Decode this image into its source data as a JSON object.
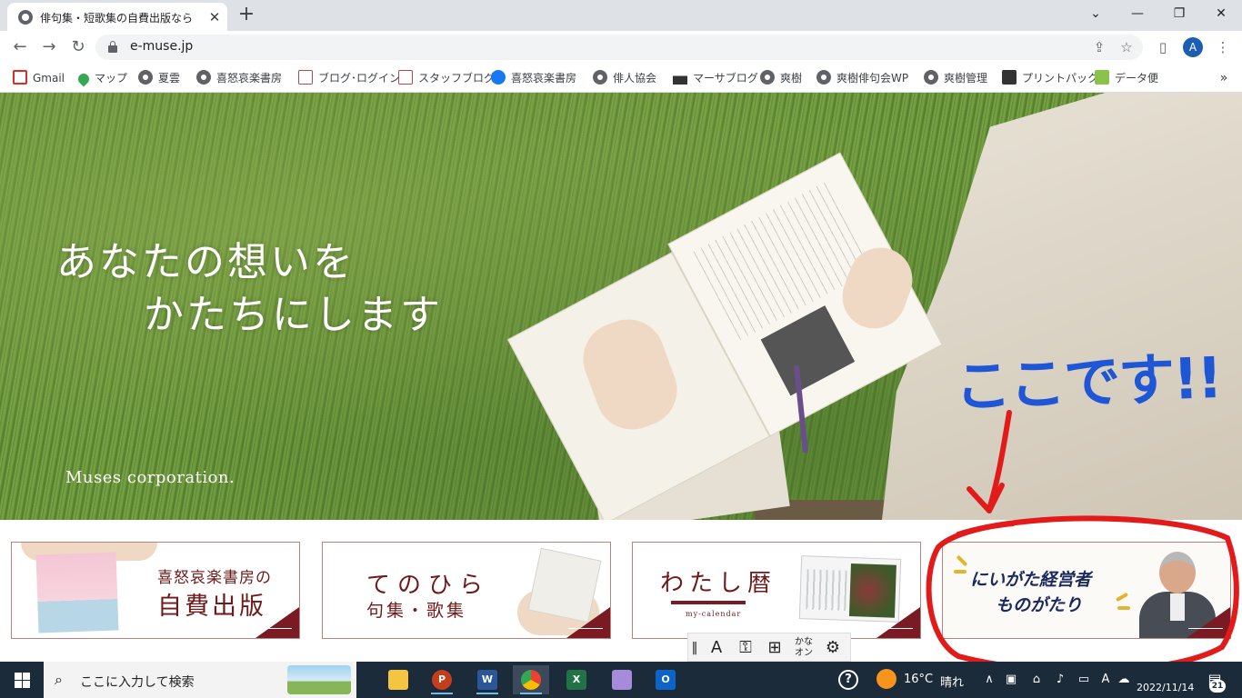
{
  "browser": {
    "tab_title": "俳句集・短歌集の自費出版なら 喜",
    "tab_close_glyph": "✕",
    "new_tab_glyph": "+",
    "url": "e-muse.jp",
    "window_controls": {
      "tabs_menu": "⌄",
      "minimize": "—",
      "restore": "❐",
      "close": "✕"
    },
    "avatar_letter": "A",
    "more_glyph": "⋮",
    "bookmarks_more_glyph": "»",
    "bookmarks": [
      {
        "label": "Gmail",
        "icon": "gmail-icon"
      },
      {
        "label": "マップ",
        "icon": "maps-icon"
      },
      {
        "label": "夏雲",
        "icon": "globe-icon"
      },
      {
        "label": "喜怒哀楽書房",
        "icon": "globe-icon"
      },
      {
        "label": "ブログ･ログイン",
        "icon": "blog-icon"
      },
      {
        "label": "スタッフブログ",
        "icon": "blog-icon"
      },
      {
        "label": "喜怒哀楽書房",
        "icon": "facebook-icon"
      },
      {
        "label": "俳人協会",
        "icon": "globe-icon"
      },
      {
        "label": "マーサブログ",
        "icon": "muse-icon"
      },
      {
        "label": "爽樹",
        "icon": "globe-icon"
      },
      {
        "label": "爽樹俳句会WP",
        "icon": "globe-icon"
      },
      {
        "label": "爽樹管理",
        "icon": "globe-icon"
      },
      {
        "label": "プリントパック",
        "icon": "printpac-icon"
      },
      {
        "label": "データ便",
        "icon": "cube-icon"
      }
    ]
  },
  "hero": {
    "headline_line1": "あなたの想いを",
    "headline_line2": "かたちにします",
    "brand": "Muses corporation.",
    "annotation": "ここです!!"
  },
  "banners": [
    {
      "line1": "喜怒哀楽書房の",
      "line2": "自費出版"
    },
    {
      "line1": "てのひら",
      "line2": "句集・歌集"
    },
    {
      "line1": "わたし暦",
      "line2": "my-calendar"
    },
    {
      "line1": "にいがた経営者",
      "line2": "ものがたり"
    }
  ],
  "ime": {
    "mode": "A",
    "kana_line1": "かな",
    "kana_line2": "オン"
  },
  "taskbar": {
    "search_placeholder": "ここに入力して検索",
    "temperature": "16°C",
    "weather": "晴れ",
    "ime_indicator": "A",
    "date": "2022/11/14",
    "notification_count": "21",
    "apps": [
      {
        "name": "File Explorer",
        "label": "",
        "color": "#f5c542"
      },
      {
        "name": "PowerPoint",
        "label": "P",
        "color": "#c43e1c"
      },
      {
        "name": "Word",
        "label": "W",
        "color": "#2b579a"
      },
      {
        "name": "Chrome",
        "label": "",
        "color": "#4285f4"
      },
      {
        "name": "Excel",
        "label": "X",
        "color": "#217346"
      },
      {
        "name": "Visual Studio",
        "label": "",
        "color": "#a58bd9"
      },
      {
        "name": "Outlook",
        "label": "O",
        "color": "#0a64c9"
      }
    ]
  },
  "colors": {
    "annotation_blue": "#1e56d6",
    "annotation_red": "#e21a1a",
    "banner_maroon": "#7a1a22",
    "taskbar_bg": "#1c2b3a"
  }
}
